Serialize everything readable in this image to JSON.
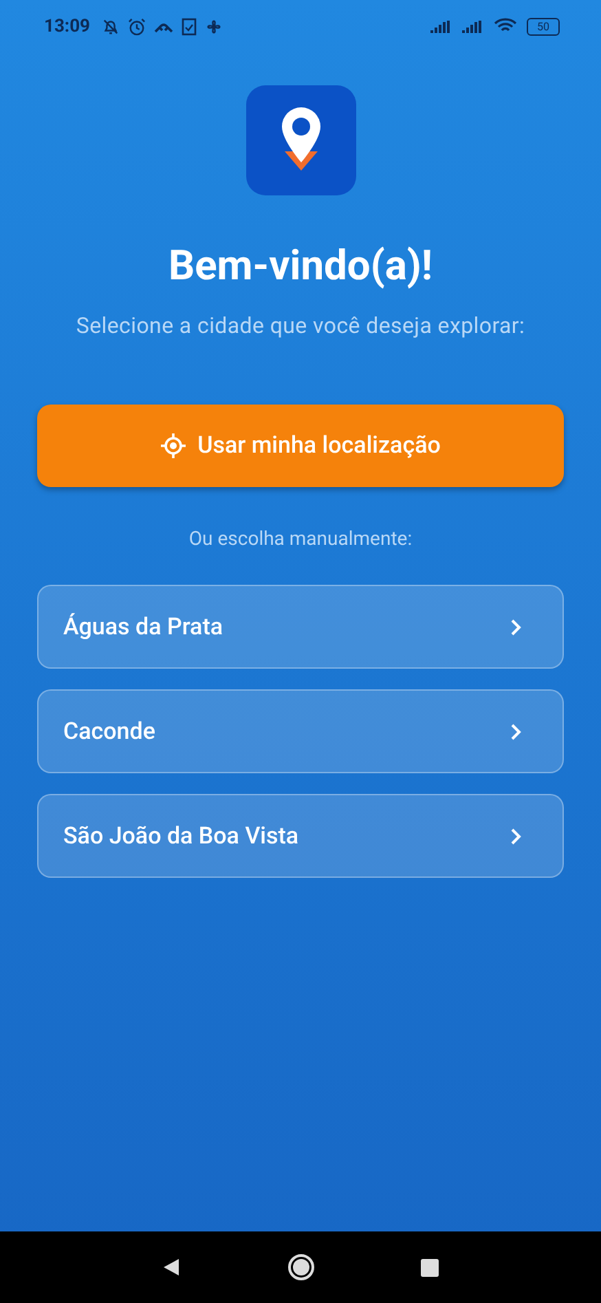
{
  "status_bar": {
    "time": "13:09",
    "battery": "50"
  },
  "title": "Bem-vindo(a)!",
  "subtitle": "Selecione a cidade que você deseja explorar:",
  "location_button": {
    "label": "Usar minha localização"
  },
  "manual_label": "Ou escolha manualmente:",
  "cities": [
    {
      "name": "Águas da Prata"
    },
    {
      "name": "Caconde"
    },
    {
      "name": "São João da Boa Vista"
    }
  ]
}
